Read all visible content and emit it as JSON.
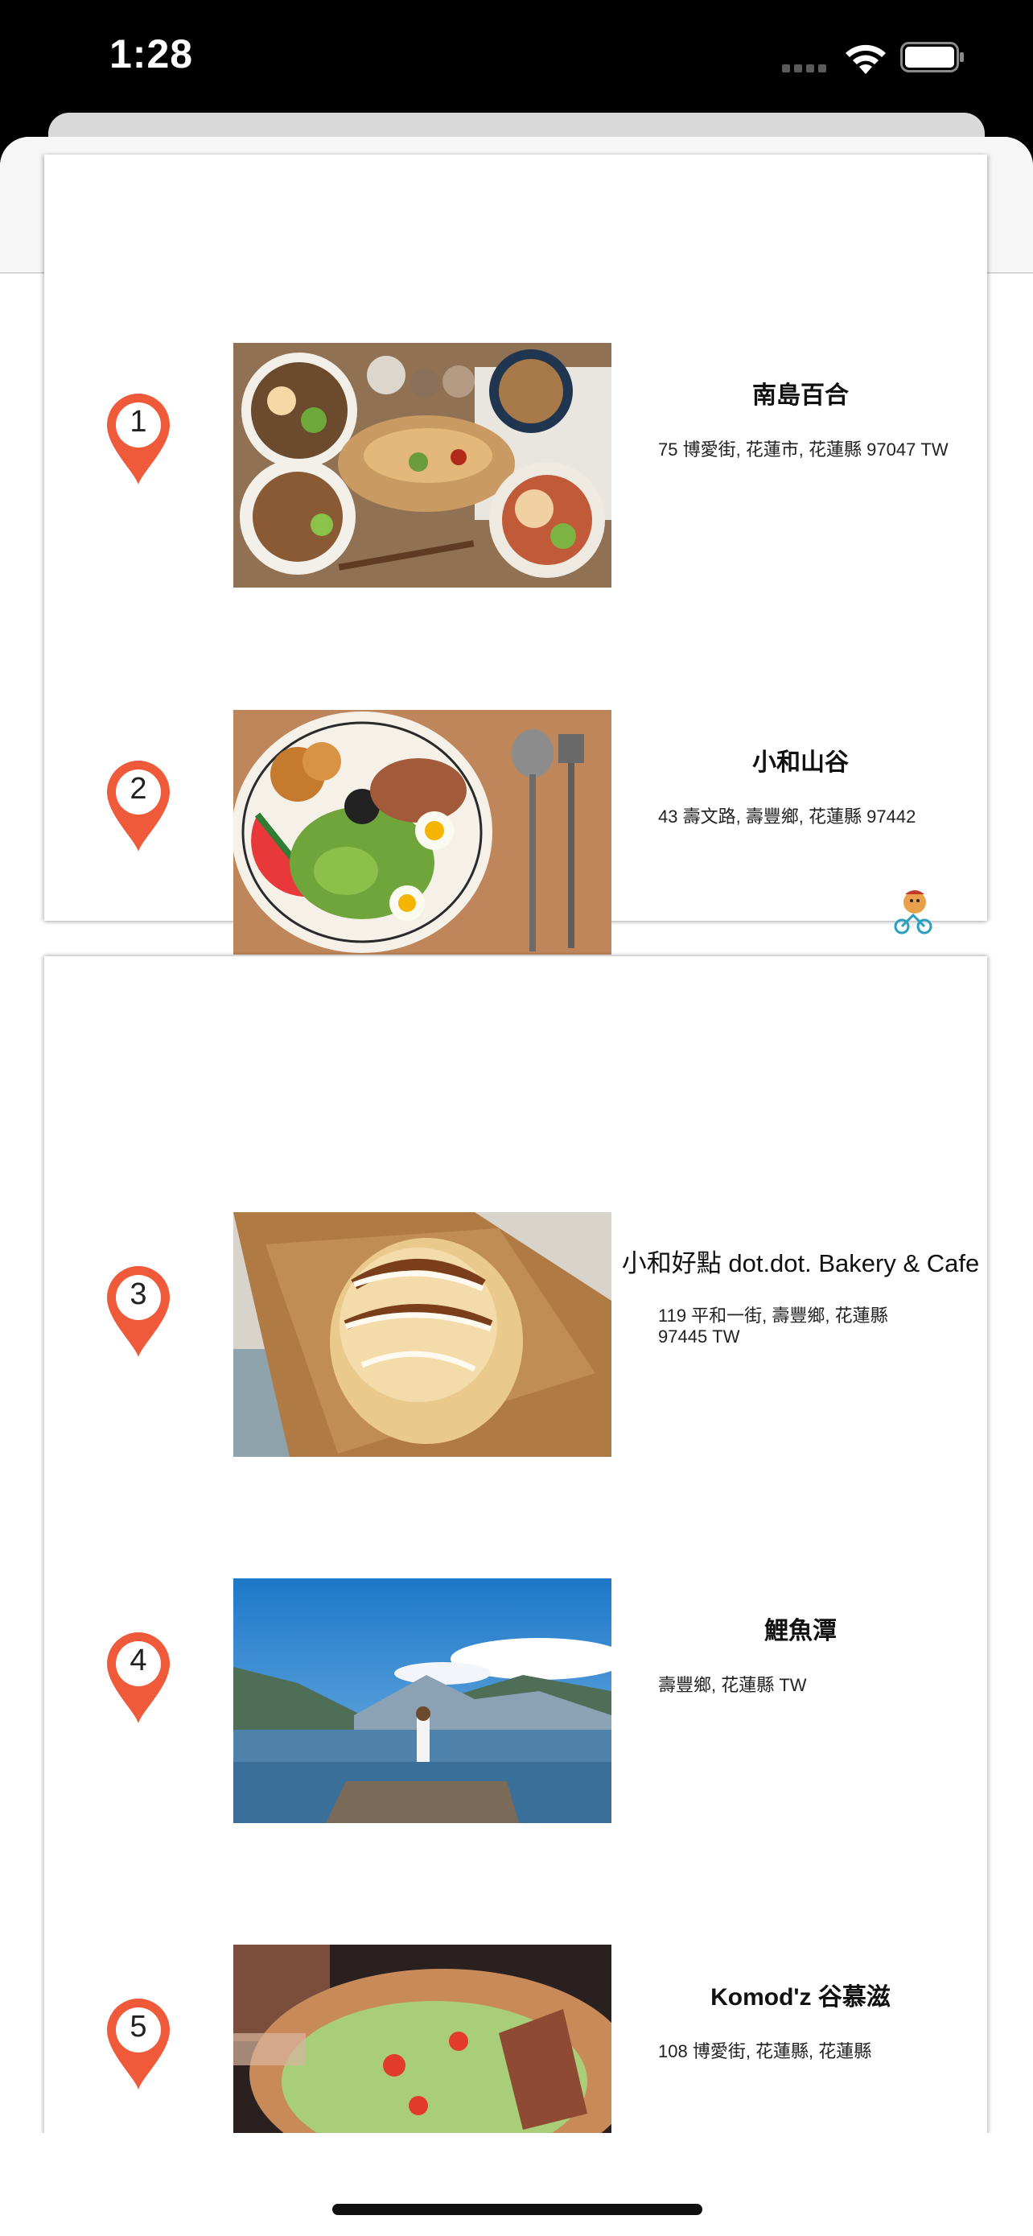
{
  "status_bar": {
    "time": "1:28"
  },
  "toolbar": {
    "share_icon": "share-icon"
  },
  "places": [
    {
      "number": "1",
      "name": "南島百合",
      "address": "75 博愛街, 花蓮市, 花蓮縣 97047 TW"
    },
    {
      "number": "2",
      "name": "小和山谷",
      "address": "43 壽文路, 壽豐鄉, 花蓮縣 97442"
    },
    {
      "number": "3",
      "name": "小和好點 dot.dot. Bakery & Cafe",
      "address": "119 平和一街, 壽豐鄉, 花蓮縣 97445 TW"
    },
    {
      "number": "4",
      "name": "鯉魚潭",
      "address": "壽豐鄉, 花蓮縣 TW"
    },
    {
      "number": "5",
      "name": "Komod'z 谷慕滋",
      "address": "108 博愛街, 花蓮縣, 花蓮縣"
    }
  ],
  "colors": {
    "pin": "#ee5a3a",
    "accent": "#1aa3b0"
  }
}
